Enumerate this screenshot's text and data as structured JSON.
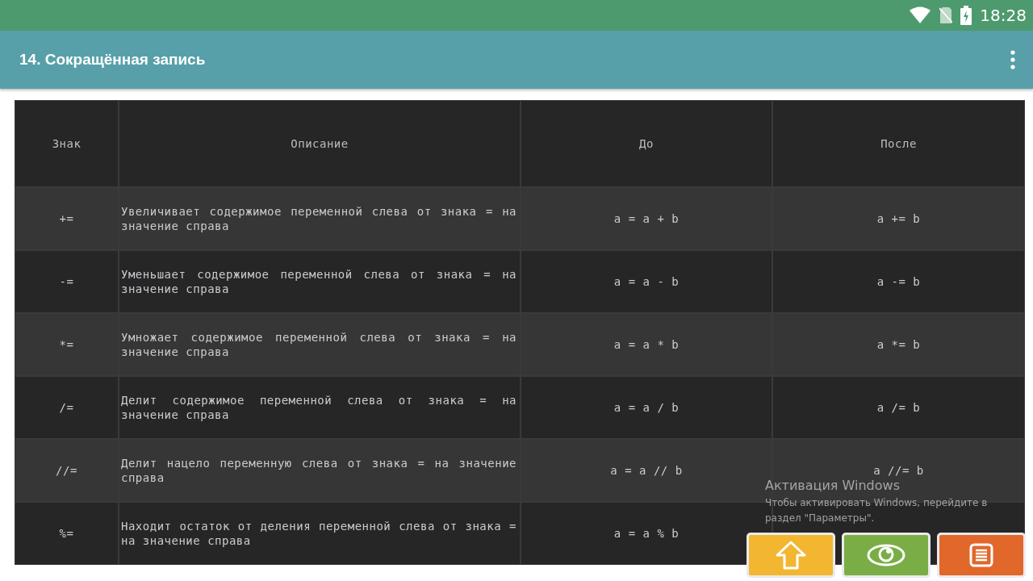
{
  "status_bar": {
    "time": "18:28"
  },
  "app_bar": {
    "title": "14. Сокращённая запись"
  },
  "table": {
    "columns": [
      "Знак",
      "Описание",
      "До",
      "После"
    ],
    "rows": [
      {
        "sign": "+=",
        "description": "Увеличивает содержимое переменной слева от знака = на значение справа",
        "before": "a = a + b",
        "after": "a += b"
      },
      {
        "sign": "-=",
        "description": "Уменьшает содержимое переменной слева от знака = на значение справа",
        "before": "a = a - b",
        "after": "a -= b"
      },
      {
        "sign": "*=",
        "description": "Умножает содержимое переменной слева от знака = на значение справа",
        "before": "a = a * b",
        "after": "a *= b"
      },
      {
        "sign": "/=",
        "description": "Делит содержимое переменной слева от знака = на значение справа",
        "before": "a = a / b",
        "after": "a /= b"
      },
      {
        "sign": "//=",
        "description": "Делит нацело переменную слева от знака = на значение справа",
        "before": "a = a // b",
        "after": "a //= b"
      },
      {
        "sign": "%=",
        "description": "Находит остаток от деления переменной слева от знака = на значение справа",
        "before": "a = a % b"
      }
    ]
  },
  "activation_notice": {
    "title": "Активация Windows",
    "text": "Чтобы активировать Windows, перейдите в раздел \"Параметры\"."
  },
  "action_buttons": [
    {
      "kind": "up",
      "color": "#f2b630"
    },
    {
      "kind": "eye",
      "color": "#7aad45"
    },
    {
      "kind": "list",
      "color": "#e2672a"
    }
  ]
}
